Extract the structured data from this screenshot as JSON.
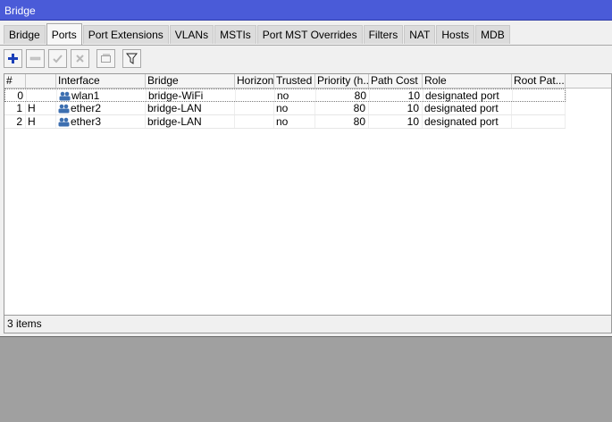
{
  "window": {
    "title": "Bridge"
  },
  "tabs": [
    {
      "label": "Bridge",
      "active": false
    },
    {
      "label": "Ports",
      "active": true
    },
    {
      "label": "Port Extensions",
      "active": false
    },
    {
      "label": "VLANs",
      "active": false
    },
    {
      "label": "MSTIs",
      "active": false
    },
    {
      "label": "Port MST Overrides",
      "active": false
    },
    {
      "label": "Filters",
      "active": false
    },
    {
      "label": "NAT",
      "active": false
    },
    {
      "label": "Hosts",
      "active": false
    },
    {
      "label": "MDB",
      "active": false
    }
  ],
  "toolbar": {
    "buttons": [
      {
        "icon": "plus-icon",
        "enabled": true
      },
      {
        "icon": "minus-icon",
        "enabled": false
      },
      {
        "icon": "check-icon",
        "enabled": false
      },
      {
        "icon": "x-icon",
        "enabled": false
      },
      {
        "icon": "comment-icon",
        "enabled": false
      },
      {
        "icon": "filter-icon",
        "enabled": true
      }
    ]
  },
  "colors": {
    "titlebar": "#4a5bd8",
    "add_icon": "#1a3fb8"
  },
  "table": {
    "columns": [
      "#",
      "",
      "Interface",
      "Bridge",
      "Horizon",
      "Trusted",
      "Priority (h...",
      "Path Cost",
      "Role",
      "Root Pat..."
    ],
    "rows": [
      {
        "num": "0",
        "flag": "",
        "interface": "wlan1",
        "bridge": "bridge-WiFi",
        "horizon": "",
        "trusted": "no",
        "priority": "80",
        "path_cost": "10",
        "role": "designated port",
        "root_path": "",
        "selected": true
      },
      {
        "num": "1",
        "flag": "H",
        "interface": "ether2",
        "bridge": "bridge-LAN",
        "horizon": "",
        "trusted": "no",
        "priority": "80",
        "path_cost": "10",
        "role": "designated port",
        "root_path": "",
        "selected": false
      },
      {
        "num": "2",
        "flag": "H",
        "interface": "ether3",
        "bridge": "bridge-LAN",
        "horizon": "",
        "trusted": "no",
        "priority": "80",
        "path_cost": "10",
        "role": "designated port",
        "root_path": "",
        "selected": false
      }
    ]
  },
  "status": {
    "text": "3 items"
  }
}
